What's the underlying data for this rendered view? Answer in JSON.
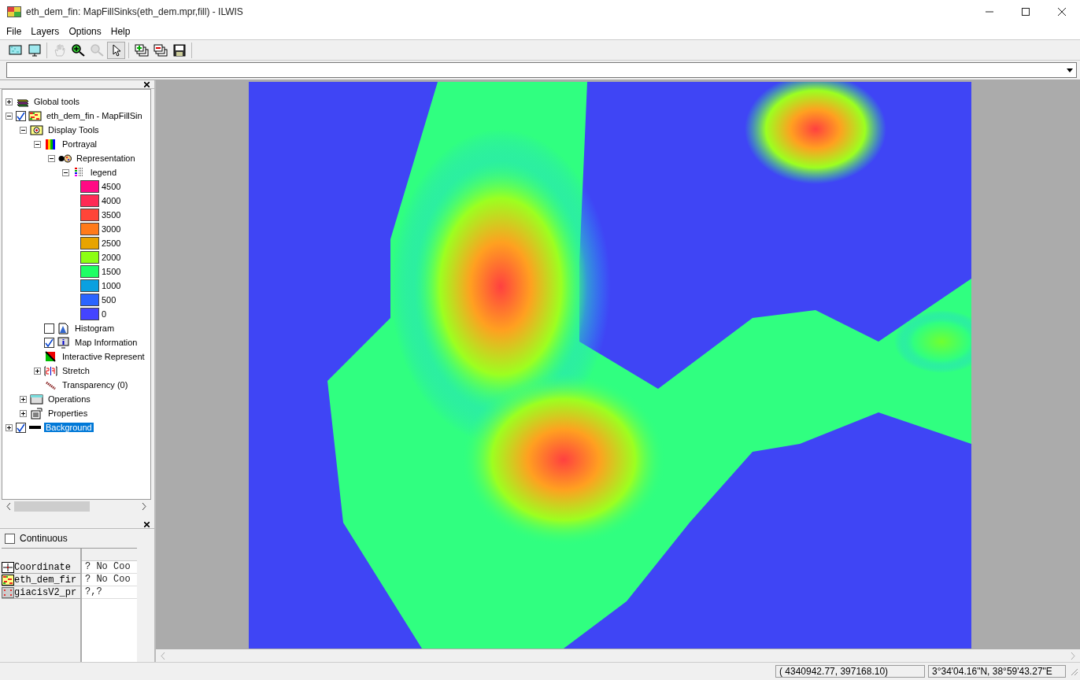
{
  "window": {
    "title": "eth_dem_fin: MapFillSinks(eth_dem.mpr,fill) - ILWIS"
  },
  "menu": [
    "File",
    "Layers",
    "Options",
    "Help"
  ],
  "toolbar": [
    {
      "kind": "entire-map",
      "selected": false,
      "disabled": false
    },
    {
      "kind": "monitor",
      "selected": false,
      "disabled": false
    },
    {
      "kind": "pan",
      "selected": false,
      "disabled": true
    },
    {
      "kind": "zoom-in",
      "selected": false,
      "disabled": false
    },
    {
      "kind": "zoom-out",
      "selected": false,
      "disabled": true
    },
    {
      "kind": "pointer",
      "selected": true,
      "disabled": false
    },
    {
      "kind": "add-layer",
      "selected": false,
      "disabled": false
    },
    {
      "kind": "remove-layer",
      "selected": false,
      "disabled": false
    },
    {
      "kind": "save",
      "selected": false,
      "disabled": false
    }
  ],
  "tree": [
    {
      "label": "Global tools",
      "kind": "tools",
      "expanded": false,
      "selected": false
    },
    {
      "label": "eth_dem_fin - MapFillSin",
      "kind": "raster",
      "expanded": true,
      "checked": true,
      "selected": false,
      "children": [
        {
          "label": "Display Tools",
          "kind": "display",
          "expanded": true,
          "selected": false,
          "children": [
            {
              "label": "Portrayal",
              "kind": "rainbow",
              "expanded": true,
              "selected": false,
              "children": [
                {
                  "label": "Representation",
                  "kind": "palette",
                  "expanded": true,
                  "selected": false,
                  "children": [
                    {
                      "label": "legend",
                      "kind": "legend",
                      "expanded": true,
                      "selected": false,
                      "classes": [
                        {
                          "value": "4500",
                          "color": "#ff0a84"
                        },
                        {
                          "value": "4000",
                          "color": "#ff2a55"
                        },
                        {
                          "value": "3500",
                          "color": "#ff4538"
                        },
                        {
                          "value": "3000",
                          "color": "#ff7a1a"
                        },
                        {
                          "value": "2500",
                          "color": "#e8a400"
                        },
                        {
                          "value": "2000",
                          "color": "#8cff12"
                        },
                        {
                          "value": "1500",
                          "color": "#1eff64"
                        },
                        {
                          "value": "1000",
                          "color": "#0aa0e0"
                        },
                        {
                          "value": "500",
                          "color": "#2a64ff"
                        },
                        {
                          "value": "0",
                          "color": "#4444ff"
                        }
                      ]
                    }
                  ]
                }
              ]
            },
            {
              "label": "Histogram",
              "kind": "histogram",
              "checked": false,
              "selected": false
            },
            {
              "label": "Map Information",
              "kind": "info",
              "checked": true,
              "selected": false
            },
            {
              "label": "Interactive Represent",
              "kind": "interactive",
              "selected": false
            },
            {
              "label": "Stretch",
              "kind": "stretch",
              "expanded": false,
              "selected": false
            },
            {
              "label": "Transparency (0)",
              "kind": "transparency",
              "selected": false
            }
          ]
        },
        {
          "label": "Operations",
          "kind": "operations",
          "expanded": false,
          "selected": false
        },
        {
          "label": "Properties",
          "kind": "properties",
          "expanded": false,
          "selected": false
        }
      ]
    },
    {
      "label": "Background",
      "kind": "line",
      "expanded": false,
      "checked": true,
      "selected": true
    }
  ],
  "info_panel": {
    "continuous": {
      "label": "Continuous",
      "checked": false
    },
    "rows": [
      {
        "kind": "coordinate",
        "name": "Coordinate",
        "value": "? No Coo"
      },
      {
        "kind": "raster",
        "name": "eth_dem_fir",
        "value": "? No Coo"
      },
      {
        "kind": "points",
        "name": "giacisV2_pr",
        "value": "?,?"
      }
    ]
  },
  "status_bar": {
    "coordinates": "( 4340942.77,   397168.10)",
    "latlon": "3°34'04.16\"N, 38°59'43.27\"E"
  }
}
